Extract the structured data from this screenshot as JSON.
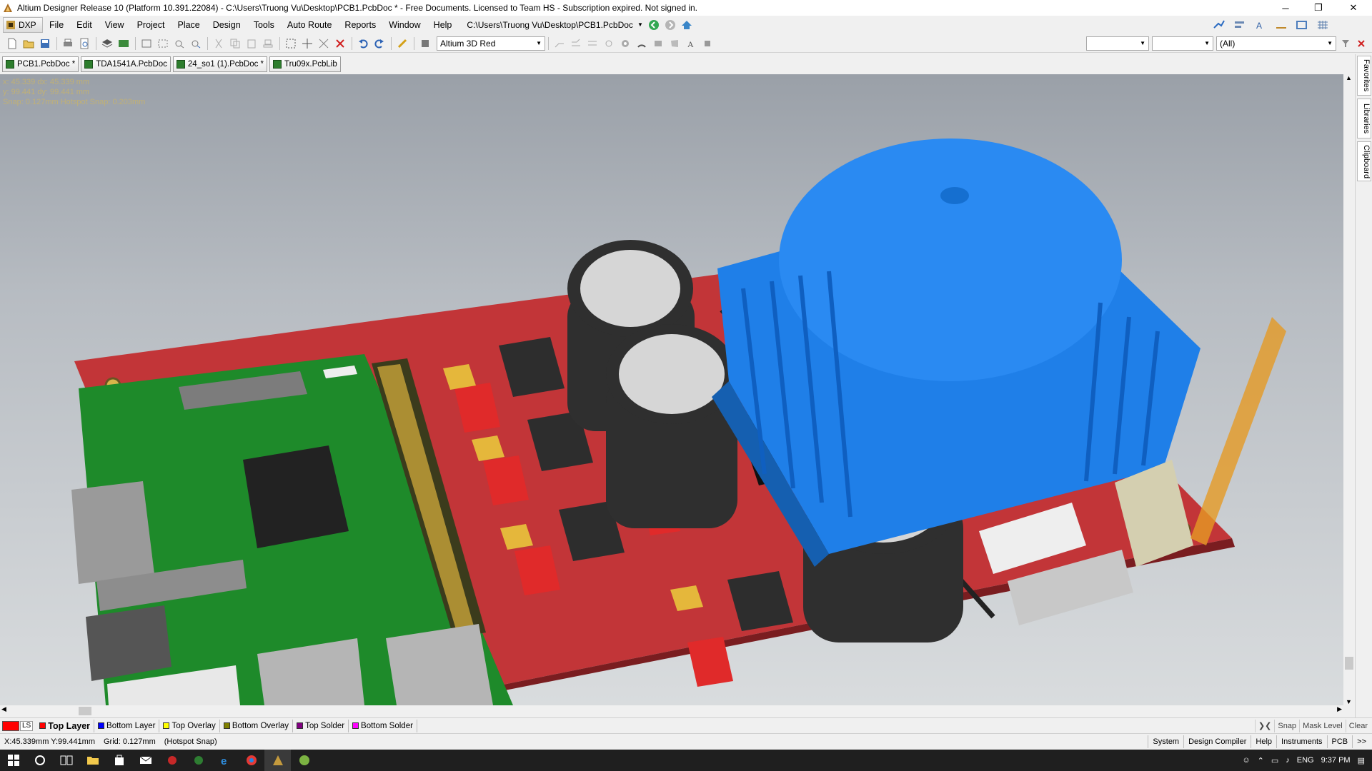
{
  "window": {
    "title": "Altium Designer Release 10 (Platform 10.391.22084) - C:\\Users\\Truong Vu\\Desktop\\PCB1.PcbDoc * - Free Documents. Licensed to Team HS - Subscription expired. Not signed in.",
    "minimize": "─",
    "maximize": "❐",
    "close": "✕"
  },
  "menubar": {
    "dxp": "DXP",
    "items": [
      "File",
      "Edit",
      "View",
      "Project",
      "Place",
      "Design",
      "Tools",
      "Auto Route",
      "Reports",
      "Window",
      "Help"
    ],
    "path": "C:\\Users\\Truong Vu\\Desktop\\PCB1.PcbDoc"
  },
  "toolbar": {
    "view_config": "Altium 3D Red",
    "filter_all": "(All)"
  },
  "doc_tabs": [
    "PCB1.PcbDoc *",
    "TDA1541A.PcbDoc",
    "24_so1 (1).PcbDoc *",
    "Tru09x.PcbLib"
  ],
  "hud": {
    "line1": "x: 45.339   dx: 45.339 mm",
    "line2": "y: 99.441   dy: 99.441 mm",
    "line3": "Snap: 0.127mm Hotspot Snap: 0.203mm"
  },
  "right_panel": {
    "tabs": [
      "Favorites",
      "Libraries",
      "Clipboard"
    ]
  },
  "layers": {
    "ls": "LS",
    "items": [
      {
        "name": "Top Layer",
        "color": "#ff0000"
      },
      {
        "name": "Bottom Layer",
        "color": "#0000ff"
      },
      {
        "name": "Top Overlay",
        "color": "#ffff00"
      },
      {
        "name": "Bottom Overlay",
        "color": "#808000"
      },
      {
        "name": "Top Solder",
        "color": "#800080"
      },
      {
        "name": "Bottom Solder",
        "color": "#ff00ff"
      }
    ],
    "right": [
      "Snap",
      "Mask Level",
      "Clear"
    ]
  },
  "status": {
    "coords": "X:45.339mm Y:99.441mm",
    "grid": "Grid: 0.127mm",
    "snap": "(Hotspot Snap)",
    "panels": [
      "System",
      "Design Compiler",
      "Help",
      "Instruments",
      "PCB",
      ">>"
    ]
  },
  "taskbar": {
    "lang": "ENG",
    "time": "9:37 PM"
  },
  "colors": {
    "board": "#c9383c",
    "heatsink": "#1f7fe8",
    "rpi": "#1e8a2a",
    "capacitor": "#2f2f2f"
  }
}
